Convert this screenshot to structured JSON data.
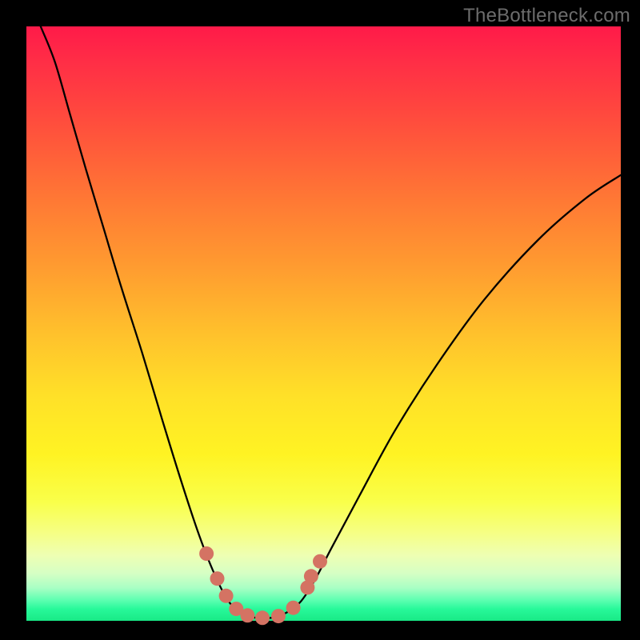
{
  "watermark": "TheBottleneck.com",
  "colors": {
    "page_bg": "#000000",
    "marker": "#d47363",
    "curve": "#000000",
    "gradient_top": "#ff1a49",
    "gradient_bottom": "#19e986"
  },
  "chart_data": {
    "type": "line",
    "title": "",
    "xlabel": "",
    "ylabel": "",
    "xlim": [
      0,
      1
    ],
    "ylim": [
      0,
      1
    ],
    "note": "No axes or tick marks shown. Curve drawn over a vertical gradient from red (top) → yellow → green (bottom). Pink dot markers sit along the bottom of the valley. Values below are normalized pixel-space samples (0,0 = top-left of plot area, 1,1 = bottom-right).",
    "series": [
      {
        "name": "bottleneck-curve",
        "points": [
          {
            "x": 0.024,
            "y": 0.0
          },
          {
            "x": 0.048,
            "y": 0.06
          },
          {
            "x": 0.074,
            "y": 0.15
          },
          {
            "x": 0.1,
            "y": 0.24
          },
          {
            "x": 0.13,
            "y": 0.34
          },
          {
            "x": 0.16,
            "y": 0.44
          },
          {
            "x": 0.195,
            "y": 0.55
          },
          {
            "x": 0.228,
            "y": 0.66
          },
          {
            "x": 0.262,
            "y": 0.77
          },
          {
            "x": 0.292,
            "y": 0.86
          },
          {
            "x": 0.318,
            "y": 0.925
          },
          {
            "x": 0.34,
            "y": 0.967
          },
          {
            "x": 0.362,
            "y": 0.987
          },
          {
            "x": 0.386,
            "y": 0.995
          },
          {
            "x": 0.412,
            "y": 0.995
          },
          {
            "x": 0.438,
            "y": 0.986
          },
          {
            "x": 0.462,
            "y": 0.967
          },
          {
            "x": 0.486,
            "y": 0.93
          },
          {
            "x": 0.512,
            "y": 0.88
          },
          {
            "x": 0.56,
            "y": 0.79
          },
          {
            "x": 0.62,
            "y": 0.68
          },
          {
            "x": 0.69,
            "y": 0.57
          },
          {
            "x": 0.77,
            "y": 0.46
          },
          {
            "x": 0.86,
            "y": 0.36
          },
          {
            "x": 0.94,
            "y": 0.29
          },
          {
            "x": 1.0,
            "y": 0.25
          }
        ]
      }
    ],
    "markers": [
      {
        "x": 0.303,
        "y": 0.887
      },
      {
        "x": 0.321,
        "y": 0.929
      },
      {
        "x": 0.336,
        "y": 0.958
      },
      {
        "x": 0.353,
        "y": 0.98
      },
      {
        "x": 0.372,
        "y": 0.991
      },
      {
        "x": 0.397,
        "y": 0.995
      },
      {
        "x": 0.424,
        "y": 0.992
      },
      {
        "x": 0.449,
        "y": 0.978
      },
      {
        "x": 0.473,
        "y": 0.944
      },
      {
        "x": 0.479,
        "y": 0.925
      },
      {
        "x": 0.494,
        "y": 0.9
      }
    ],
    "marker_radius_px": 9
  }
}
